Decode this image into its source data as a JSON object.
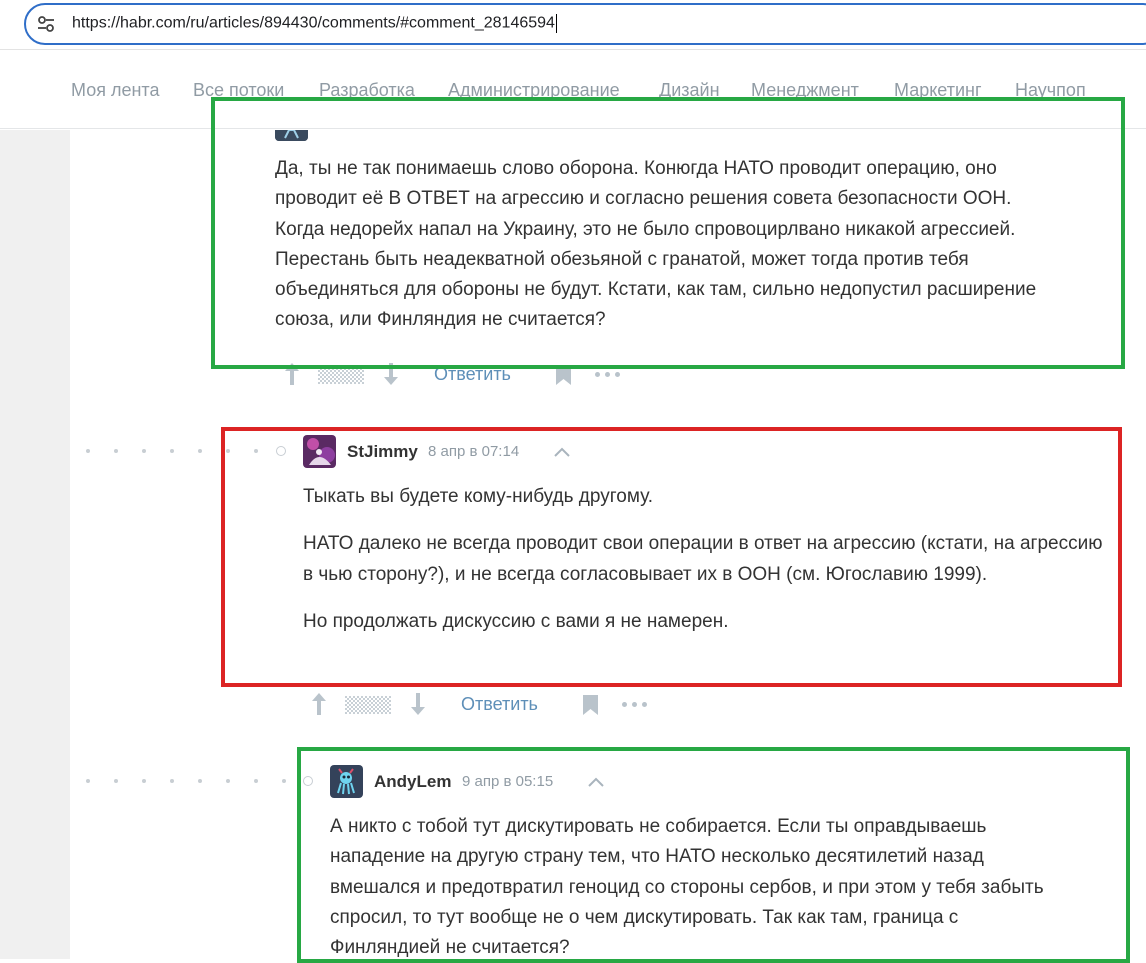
{
  "browser": {
    "url": "https://habr.com/ru/articles/894430/comments/#comment_28146594"
  },
  "hubs": [
    "Моя лента",
    "Все потоки",
    "Разработка",
    "Администрирование",
    "Дизайн",
    "Менеджмент",
    "Маркетинг",
    "Научпоп"
  ],
  "comments": [
    {
      "text_lines": [
        "Да, ты не так понимаешь слово оборона. Конюгда НАТО проводит операцию, оно",
        "проводит её В ОТВЕТ на агрессию и согласно решения совета безопасности ООН.",
        "Когда недорейх напал на Украину, это не было спровоцирлвано никакой агрессией.",
        "Перестань быть неадекватной обезьяной с гранатой, может тогда против тебя",
        "объединяться для обороны не будут. Кстати, как там, сильно недопустил расширение",
        "союза, или Финляндия не считается?"
      ],
      "actions": {
        "reply_label": "Ответить"
      }
    },
    {
      "author": "StJimmy",
      "timestamp": "8 апр в 07:14",
      "paragraphs": [
        "Тыкать вы будете кому-нибудь другому.",
        "НАТО далеко не всегда проводит свои операции в ответ на агрессию (кстати, на агрессию в чью сторону?), и не всегда согласовывает их в ООН (см. Югославию 1999).",
        "Но продолжать дискуссию с вами я не намерен."
      ],
      "actions": {
        "reply_label": "Ответить"
      }
    },
    {
      "author": "AndyLem",
      "timestamp": "9 апр в 05:15",
      "text_lines": [
        "А никто с тобой тут дискутировать не собирается. Если ты оправдываешь",
        "нападение на другую страну тем, что НАТО несколько десятилетий назад",
        "вмешался и предотвратил геноцид со стороны сербов, и при этом у тебя забыть",
        "спросил, то тут вообще не о чем дискутировать. Так как там, граница с",
        "Финляндией не считается?"
      ]
    }
  ],
  "annotations": [
    {
      "color": "#27a844",
      "label": "green"
    },
    {
      "color": "#dc2424",
      "label": "red"
    },
    {
      "color": "#27a844",
      "label": "green"
    }
  ]
}
